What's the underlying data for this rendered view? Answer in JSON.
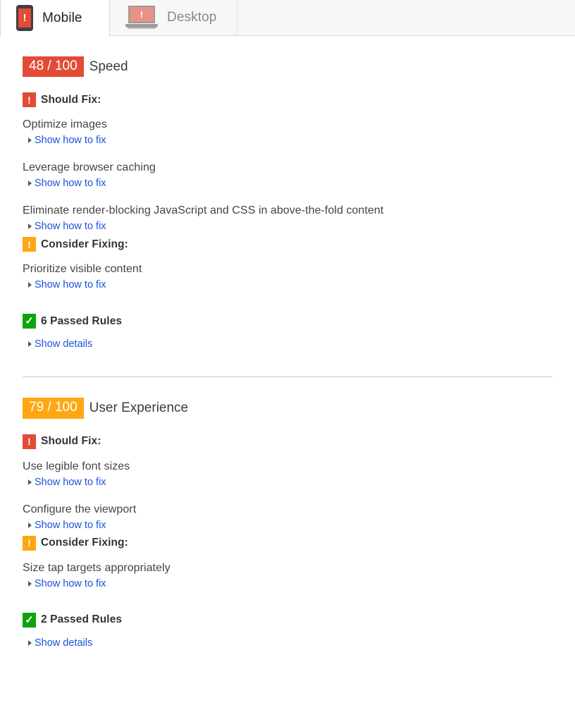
{
  "tabs": [
    {
      "label": "Mobile",
      "icon": "mobile-phone-alert-icon",
      "active": true
    },
    {
      "label": "Desktop",
      "icon": "laptop-alert-icon",
      "active": false
    }
  ],
  "colors": {
    "red": "#e24b36",
    "orange": "#ffa713",
    "green": "#0ba50b",
    "link": "#1a54d8"
  },
  "sections": [
    {
      "score": "48 / 100",
      "score_color": "#e24b36",
      "title": "Speed",
      "groups": [
        {
          "badge": "!",
          "badge_color": "#e24b36",
          "label": "Should Fix:",
          "rules": [
            {
              "title": "Optimize images",
              "link": "Show how to fix"
            },
            {
              "title": "Leverage browser caching",
              "link": "Show how to fix"
            },
            {
              "title": "Eliminate render-blocking JavaScript and CSS in above-the-fold content",
              "link": "Show how to fix"
            }
          ]
        },
        {
          "badge": "!",
          "badge_color": "#ffa713",
          "label": "Consider Fixing:",
          "rules": [
            {
              "title": "Prioritize visible content",
              "link": "Show how to fix"
            }
          ]
        }
      ],
      "passed": {
        "badge": "✓",
        "badge_color": "#0ba50b",
        "label": "6 Passed Rules",
        "link": "Show details"
      }
    },
    {
      "score": "79 / 100",
      "score_color": "#ffa713",
      "title": "User Experience",
      "groups": [
        {
          "badge": "!",
          "badge_color": "#e24b36",
          "label": "Should Fix:",
          "rules": [
            {
              "title": "Use legible font sizes",
              "link": "Show how to fix"
            },
            {
              "title": "Configure the viewport",
              "link": "Show how to fix"
            }
          ]
        },
        {
          "badge": "!",
          "badge_color": "#ffa713",
          "label": "Consider Fixing:",
          "rules": [
            {
              "title": "Size tap targets appropriately",
              "link": "Show how to fix"
            }
          ]
        }
      ],
      "passed": {
        "badge": "✓",
        "badge_color": "#0ba50b",
        "label": "2 Passed Rules",
        "link": "Show details"
      }
    }
  ]
}
